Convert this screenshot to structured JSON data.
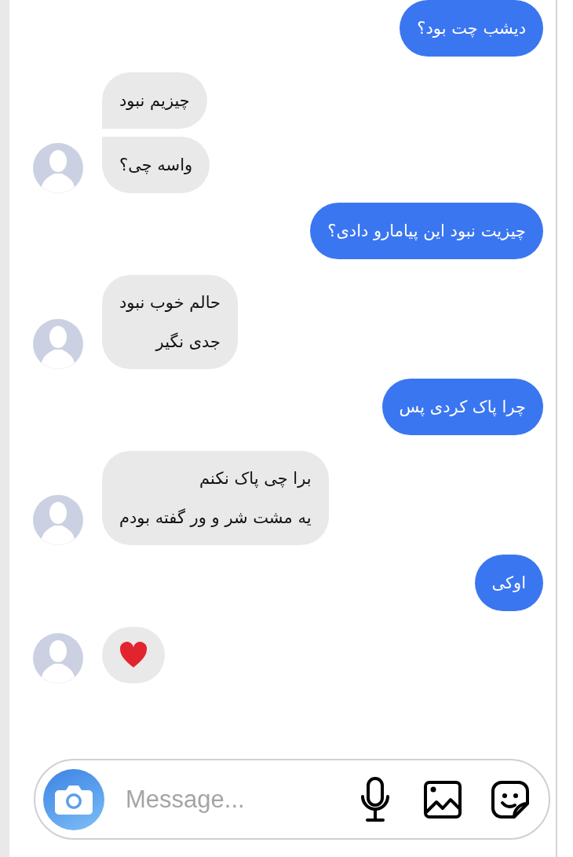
{
  "conversation": [
    {
      "kind": "sent",
      "bubbles": [
        {
          "kind": "text",
          "lines": [
            "دیشب چت بود؟"
          ]
        }
      ]
    },
    {
      "kind": "received",
      "bubbles": [
        {
          "kind": "text",
          "lines": [
            "چیزیم نبود"
          ]
        },
        {
          "kind": "text",
          "lines": [
            "واسه چی؟"
          ]
        }
      ]
    },
    {
      "kind": "sent",
      "bubbles": [
        {
          "kind": "text",
          "lines": [
            "چیزیت نبود این پیامارو دادی؟"
          ]
        }
      ]
    },
    {
      "kind": "received",
      "bubbles": [
        {
          "kind": "text",
          "lines": [
            "حالم خوب نبود",
            "جدی نگیر"
          ]
        }
      ]
    },
    {
      "kind": "sent",
      "bubbles": [
        {
          "kind": "text",
          "lines": [
            "چرا پاک کردی پس"
          ]
        }
      ]
    },
    {
      "kind": "received",
      "bubbles": [
        {
          "kind": "text",
          "lines": [
            "برا چی پاک نکنم",
            "یه مشت شر و ور گفته بودم"
          ]
        }
      ]
    },
    {
      "kind": "sent",
      "bubbles": [
        {
          "kind": "text",
          "lines": [
            "اوکی"
          ]
        }
      ]
    },
    {
      "kind": "received",
      "bubbles": [
        {
          "kind": "heart"
        }
      ]
    }
  ],
  "composer": {
    "placeholder": "Message..."
  }
}
